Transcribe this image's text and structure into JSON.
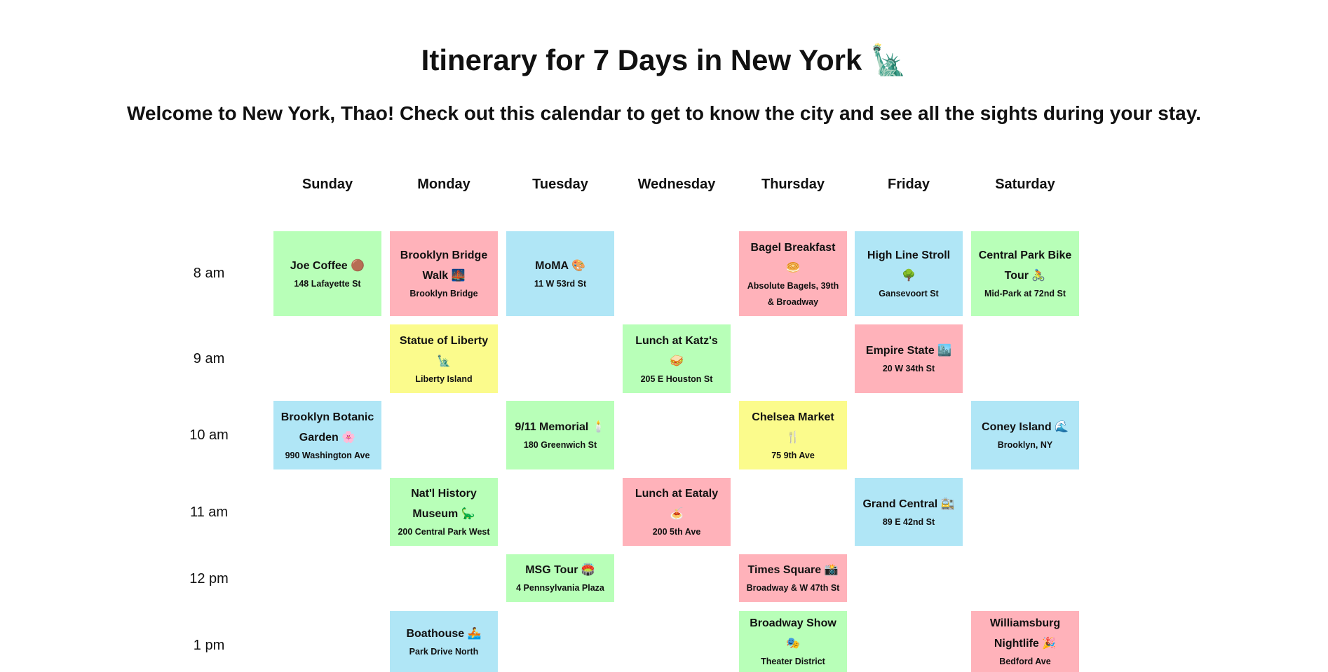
{
  "page": {
    "title": "Itinerary for 7 Days in New York 🗽",
    "subtitle": "Welcome to New York, Thao! Check out this calendar to get to know the city and see all the sights during your stay."
  },
  "calendar": {
    "days": [
      "Sunday",
      "Monday",
      "Tuesday",
      "Wednesday",
      "Thursday",
      "Friday",
      "Saturday"
    ],
    "times": [
      "8 am",
      "9 am",
      "10 am",
      "11 am",
      "12 pm",
      "1 pm"
    ],
    "colors": {
      "green": "#b8ffb8",
      "red": "#ffb2ba",
      "blue": "#b0e6f6",
      "yellow": "#fbfb8c"
    },
    "events": {
      "joe_coffee": {
        "day": "Sunday",
        "time": "8 am",
        "name": "Joe Coffee 🟤",
        "address": "148 Lafayette St",
        "color": "green"
      },
      "brooklyn_bridge": {
        "day": "Monday",
        "time": "8 am",
        "name": "Brooklyn Bridge Walk 🌉",
        "address": "Brooklyn Bridge",
        "color": "red"
      },
      "moma": {
        "day": "Tuesday",
        "time": "8 am",
        "name": "MoMA 🎨",
        "address": "11 W 53rd St",
        "color": "blue"
      },
      "bagel_breakfast": {
        "day": "Thursday",
        "time": "8 am",
        "name": "Bagel Breakfast 🥯",
        "address": "Absolute Bagels, 39th & Broadway",
        "color": "red"
      },
      "high_line": {
        "day": "Friday",
        "time": "8 am",
        "name": "High Line Stroll 🌳",
        "address": "Gansevoort St",
        "color": "blue"
      },
      "central_park_bike": {
        "day": "Saturday",
        "time": "8 am",
        "name": "Central Park Bike Tour 🚴",
        "address": "Mid-Park at 72nd St",
        "color": "green"
      },
      "statue_of_liberty": {
        "day": "Monday",
        "time": "9 am",
        "name": "Statue of Liberty 🗽",
        "address": "Liberty Island",
        "color": "yellow"
      },
      "katz": {
        "day": "Wednesday",
        "time": "9 am",
        "name": "Lunch at Katz's 🥪",
        "address": "205 E Houston St",
        "color": "green"
      },
      "empire_state": {
        "day": "Friday",
        "time": "9 am",
        "name": "Empire State 🏙️",
        "address": "20 W 34th St",
        "color": "red"
      },
      "botanic_garden": {
        "day": "Sunday",
        "time": "10 am",
        "name": "Brooklyn Botanic Garden 🌸",
        "address": "990 Washington Ave",
        "color": "blue"
      },
      "memorial_911": {
        "day": "Tuesday",
        "time": "10 am",
        "name": "9/11 Memorial 🕯️",
        "address": "180 Greenwich St",
        "color": "green"
      },
      "chelsea_market": {
        "day": "Thursday",
        "time": "10 am",
        "name": "Chelsea Market 🍴",
        "address": "75 9th Ave",
        "color": "yellow"
      },
      "coney_island": {
        "day": "Saturday",
        "time": "10 am",
        "name": "Coney Island 🌊",
        "address": "Brooklyn, NY",
        "color": "blue"
      },
      "natural_history": {
        "day": "Monday",
        "time": "11 am",
        "name": "Nat'l History Museum 🦕",
        "address": "200 Central Park West",
        "color": "green"
      },
      "eataly": {
        "day": "Wednesday",
        "time": "11 am",
        "name": "Lunch at Eataly 🍝",
        "address": "200 5th Ave",
        "color": "red"
      },
      "grand_central": {
        "day": "Friday",
        "time": "11 am",
        "name": "Grand Central 🚉",
        "address": "89 E 42nd St",
        "color": "blue"
      },
      "msg_tour": {
        "day": "Tuesday",
        "time": "12 pm",
        "name": "MSG Tour 🏟️",
        "address": "4 Pennsylvania Plaza",
        "color": "green"
      },
      "times_square": {
        "day": "Thursday",
        "time": "12 pm",
        "name": "Times Square 📸",
        "address": "Broadway & W 47th St",
        "color": "red"
      },
      "boathouse": {
        "day": "Monday",
        "time": "1 pm",
        "name": "Boathouse 🚣",
        "address": "Park Drive North",
        "color": "blue"
      },
      "broadway_show": {
        "day": "Thursday",
        "time": "1 pm",
        "name": "Broadway Show 🎭",
        "address": "Theater District",
        "color": "green"
      },
      "williamsburg": {
        "day": "Saturday",
        "time": "1 pm",
        "name": "Williamsburg Nightlife 🎉",
        "address": "Bedford Ave",
        "color": "red"
      }
    }
  }
}
